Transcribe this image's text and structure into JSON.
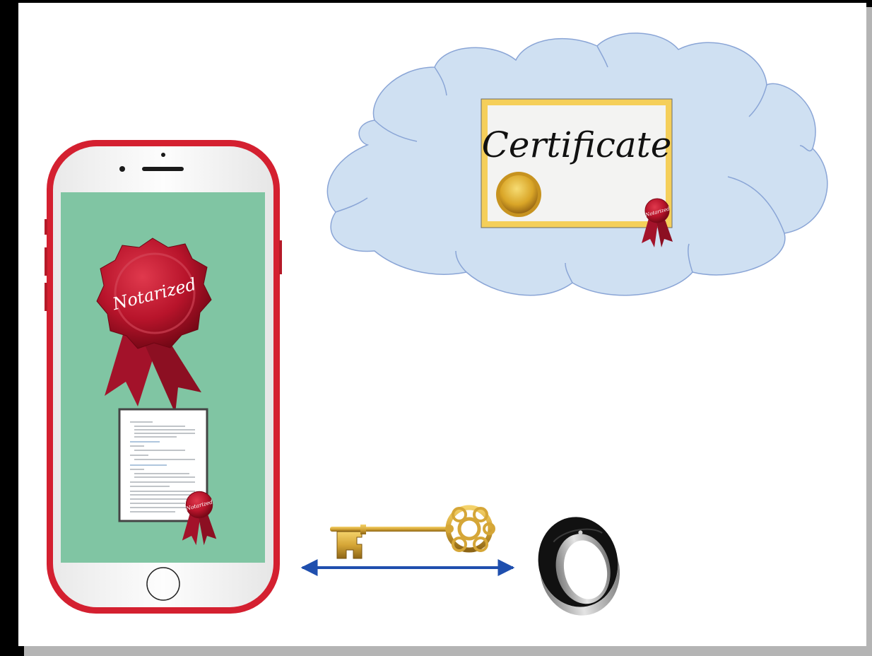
{
  "colors": {
    "frame_background": "#000000",
    "slide_background": "#ffffff",
    "slide_shadow": "#b4b4b4",
    "cloud_fill": "#cfe0f2",
    "cloud_stroke": "#8aa5d6",
    "phone_body": "#d42030",
    "phone_face": "#f6f6f6",
    "phone_screen": "#80c5a3",
    "seal_red": "#b8142b",
    "certificate_border": "#f5cf5a",
    "gold_seal": "#d9a527",
    "key_gold": "#d5a637",
    "arrow_blue": "#1f4fae",
    "ring_black": "#0c0c0c",
    "ring_steel": "#a7a7a7"
  },
  "cloud": {
    "icon": "cloud-shape",
    "certificate": {
      "title": "Certificate",
      "seal_label": "Notarized",
      "icons": [
        "gold-seal-icon",
        "notary-ribbon-icon"
      ]
    }
  },
  "phone": {
    "icon": "smartphone-icon",
    "seal_label": "Notarized",
    "document": {
      "icon": "document-thumbnail",
      "seal_label": "Notarized"
    }
  },
  "key": {
    "icon": "golden-key-icon"
  },
  "arrow": {
    "icon": "double-arrow-icon",
    "direction": "both"
  },
  "ring": {
    "icon": "smart-ring-icon"
  }
}
